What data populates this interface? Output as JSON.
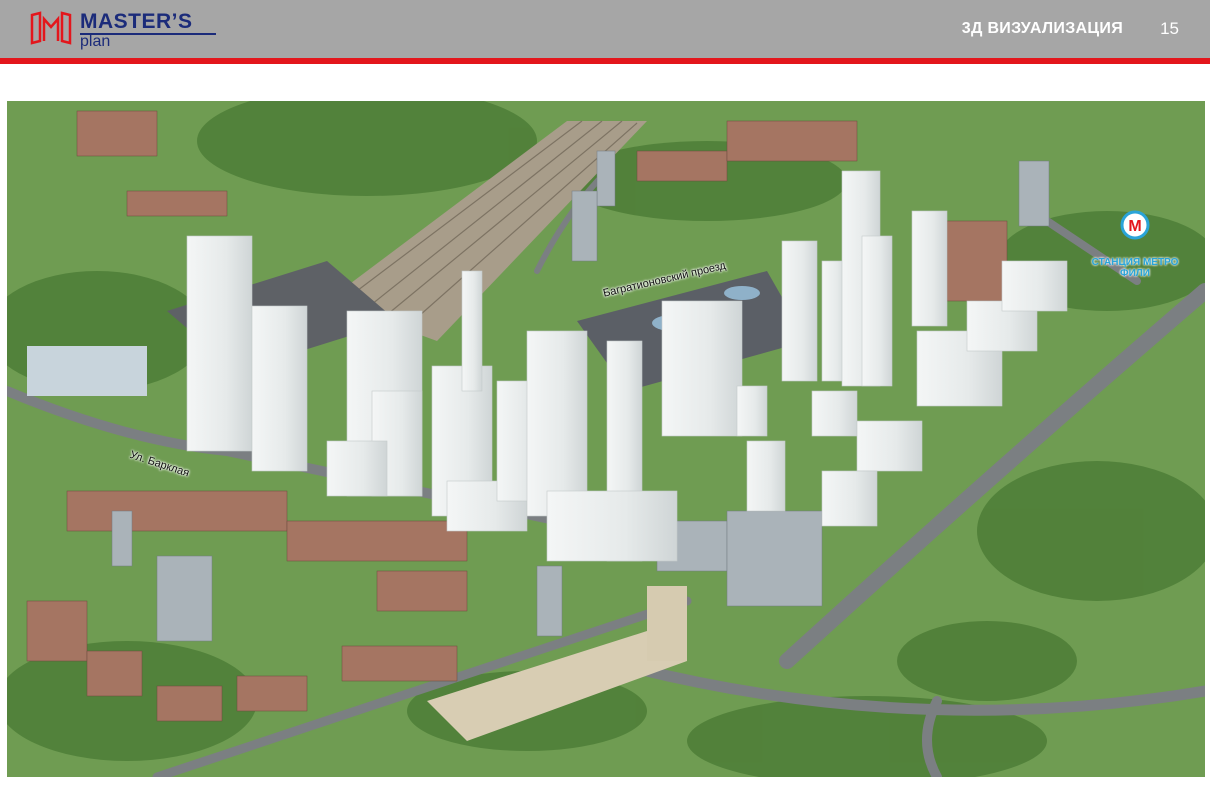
{
  "header": {
    "logo": {
      "word1": "MASTER’S",
      "word2": "plan"
    },
    "section_title": "3Д ВИЗУАЛИЗАЦИЯ",
    "page_number": "15"
  },
  "map": {
    "labels": {
      "street_barclay": "Ул. Барклая",
      "bagrationovsky": "Багратионовский проезд",
      "metro_station": "СТАНЦИЯ МЕТРО\nФИЛИ"
    },
    "metro_symbol": "М"
  },
  "colors": {
    "header_bg": "#a6a6a6",
    "accent_red": "#e3161c",
    "logo_blue": "#1b2b7a",
    "metro_blue": "#2aa4d8"
  }
}
